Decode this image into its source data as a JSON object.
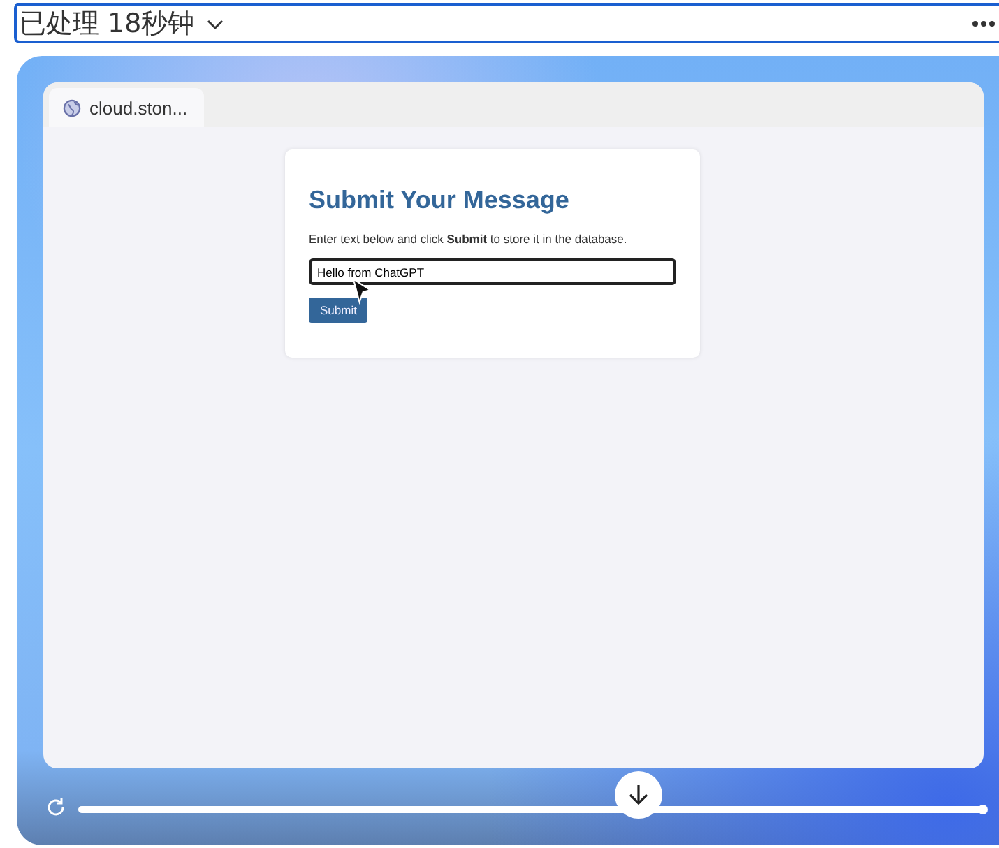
{
  "status": {
    "label": "已处理 18秒钟",
    "expanded": false
  },
  "browser": {
    "tab": {
      "title": "cloud.ston..."
    },
    "page": {
      "heading": "Submit Your Message",
      "instructions": "Enter text below and click **Submit** to store it in the database.",
      "input": {
        "value": "Hello from ChatGPT"
      },
      "button": "Submit"
    }
  },
  "playback": {
    "level": 1
  }
}
